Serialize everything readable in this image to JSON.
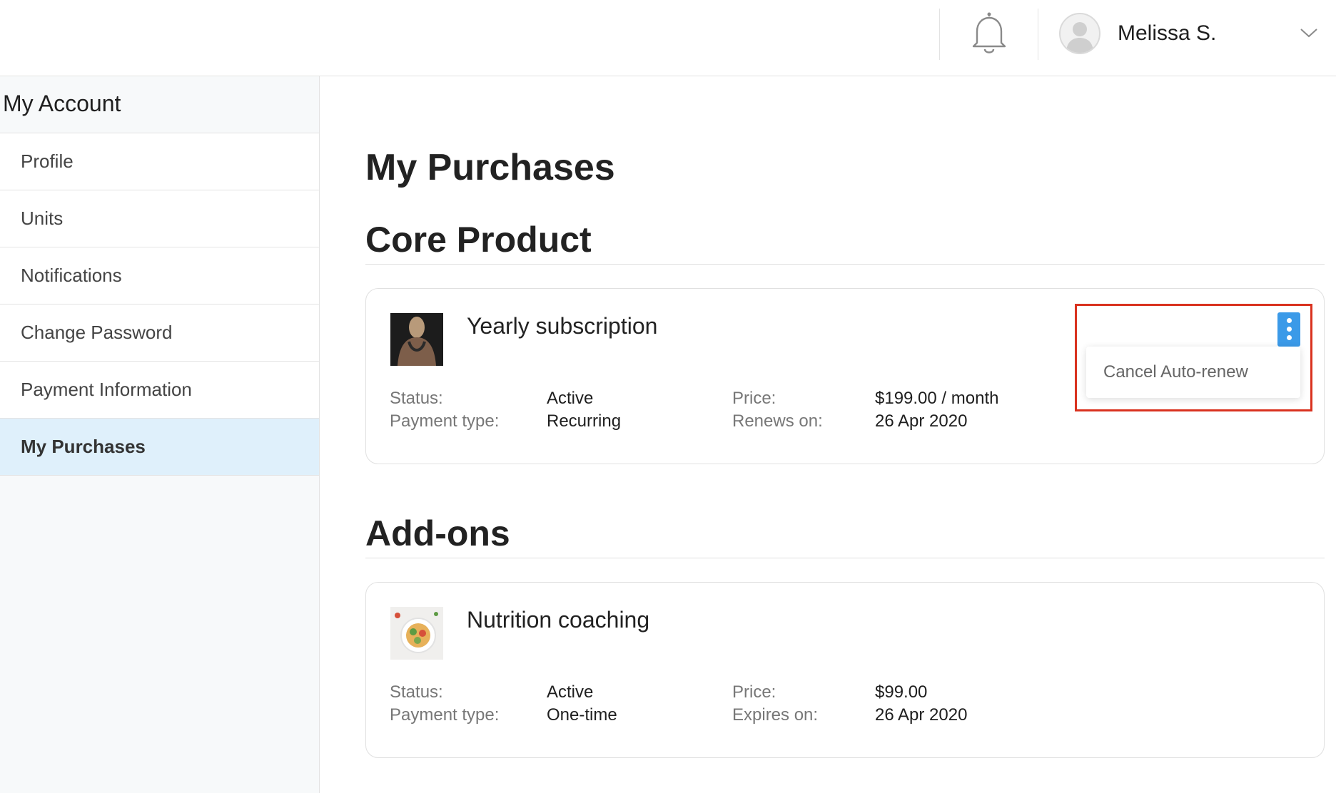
{
  "header": {
    "notifications_icon": "bell-icon",
    "user": {
      "name": "Melissa S.",
      "avatar_icon": "user-avatar-icon",
      "menu_icon": "chevron-down-icon"
    }
  },
  "sidebar": {
    "heading": "My Account",
    "items": [
      {
        "label": "Profile",
        "active": false
      },
      {
        "label": "Units",
        "active": false
      },
      {
        "label": "Notifications",
        "active": false
      },
      {
        "label": "Change Password",
        "active": false
      },
      {
        "label": "Payment Information",
        "active": false
      },
      {
        "label": "My Purchases",
        "active": true
      }
    ]
  },
  "main": {
    "title": "My Purchases",
    "core": {
      "heading": "Core Product",
      "product": {
        "name": "Yearly subscription",
        "status_label": "Status:",
        "status": "Active",
        "payment_type_label": "Payment type:",
        "payment_type": "Recurring",
        "price_label": "Price:",
        "price": "$199.00 / month",
        "date_label": "Renews on:",
        "date": "26 Apr 2020",
        "menu": {
          "icon": "more-vertical-icon",
          "items": [
            "Cancel Auto-renew"
          ]
        }
      }
    },
    "addons": {
      "heading": "Add-ons",
      "product": {
        "name": "Nutrition coaching",
        "status_label": "Status:",
        "status": "Active",
        "payment_type_label": "Payment type:",
        "payment_type": "One-time",
        "price_label": "Price:",
        "price": "$99.00",
        "date_label": "Expires on:",
        "date": "26 Apr 2020"
      }
    }
  },
  "colors": {
    "accent": "#3b9ae8",
    "active_nav_bg": "#dff0fb",
    "highlight_border": "#d9321f"
  }
}
